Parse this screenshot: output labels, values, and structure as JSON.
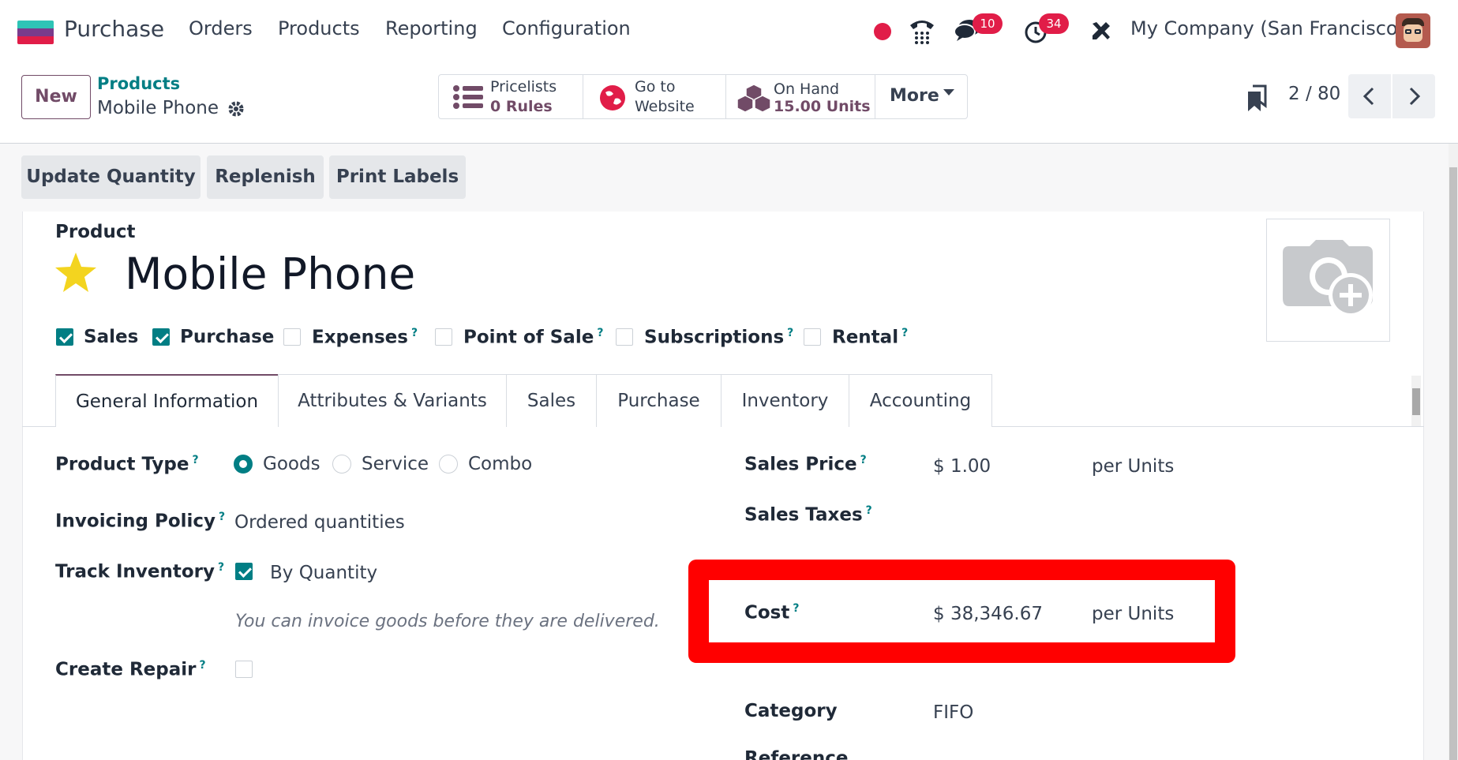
{
  "nav": {
    "app": "Purchase",
    "menu": [
      "Orders",
      "Products",
      "Reporting",
      "Configuration"
    ],
    "messages_badge": "10",
    "activities_badge": "34",
    "company": "My Company (San Francisco)",
    "logo_colors": [
      "#2ec4b6",
      "#7a3b8c",
      "#e11d48"
    ]
  },
  "control": {
    "new_label": "New",
    "breadcrumb_parent": "Products",
    "breadcrumb_current": "Mobile Phone",
    "smart": {
      "pricelists_title": "Pricelists",
      "pricelists_value": "0  Rules",
      "website_title": "Go to",
      "website_value": "Website",
      "onhand_title": "On Hand",
      "onhand_value": "15.00 Units",
      "more": "More"
    },
    "pager": "2 / 80"
  },
  "actions": [
    "Update Quantity",
    "Replenish",
    "Print Labels"
  ],
  "form": {
    "section_label": "Product",
    "name": "Mobile Phone",
    "flags": [
      {
        "label": "Sales",
        "checked": true,
        "help": false
      },
      {
        "label": "Purchase",
        "checked": true,
        "help": false
      },
      {
        "label": "Expenses",
        "checked": false,
        "help": true
      },
      {
        "label": "Point of Sale",
        "checked": false,
        "help": true
      },
      {
        "label": "Subscriptions",
        "checked": false,
        "help": true
      },
      {
        "label": "Rental",
        "checked": false,
        "help": true
      }
    ],
    "tabs": [
      "General Information",
      "Attributes & Variants",
      "Sales",
      "Purchase",
      "Inventory",
      "Accounting"
    ],
    "active_tab": "General Information",
    "left": {
      "product_type_label": "Product Type",
      "product_type_options": [
        "Goods",
        "Service",
        "Combo"
      ],
      "product_type_selected": "Goods",
      "invoicing_policy_label": "Invoicing Policy",
      "invoicing_policy_value": "Ordered quantities",
      "track_inventory_label": "Track Inventory",
      "track_inventory_value": "By Quantity",
      "track_inventory_checked": true,
      "note": "You can invoice goods before they are delivered.",
      "create_repair_label": "Create Repair",
      "create_repair_checked": false
    },
    "right": {
      "sales_price_label": "Sales Price",
      "sales_price_value": "$ 1.00",
      "sales_price_unit": "per Units",
      "sales_taxes_label": "Sales Taxes",
      "cost_label": "Cost",
      "cost_value": "$ 38,346.67",
      "cost_unit": "per Units",
      "category_label": "Category",
      "category_value": "FIFO",
      "reference_label": "Reference"
    },
    "help_mark": "?"
  },
  "colors": {
    "brand": "#714b67",
    "teal": "#017e84",
    "highlight": "#ff0000",
    "badge": "#e11d48",
    "star": "#f3d41f"
  }
}
